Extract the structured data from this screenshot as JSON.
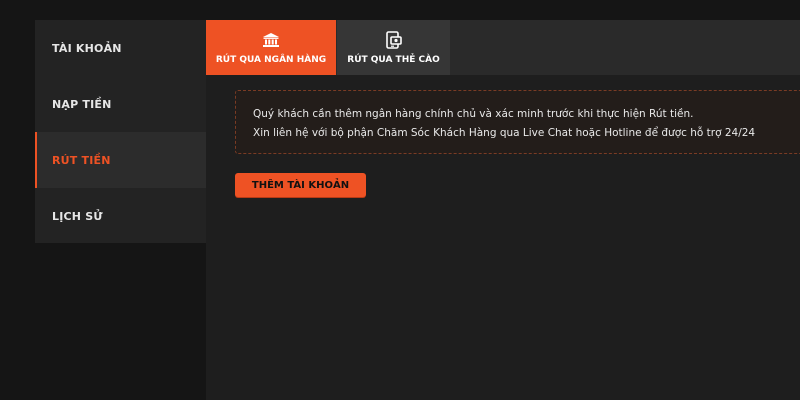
{
  "sidebar": {
    "items": [
      {
        "label": "TÀI KHOẢN"
      },
      {
        "label": "NẠP TIỀN"
      },
      {
        "label": "RÚT TIỀN",
        "active": true
      },
      {
        "label": "LỊCH SỬ"
      }
    ]
  },
  "tabs": [
    {
      "label": "RÚT QUA NGÂN HÀNG",
      "icon": "bank-icon",
      "active": true
    },
    {
      "label": "RÚT QUA THẺ CÀO",
      "icon": "phone-card-icon"
    }
  ],
  "notice": {
    "line1": "Quý khách cần thêm ngân hàng chính chủ và xác minh trước khi thực hiện Rút tiền.",
    "line2": "Xin liên hệ với bộ phận Chăm Sóc Khách Hàng qua Live Chat hoặc Hotline để được hỗ trợ 24/24"
  },
  "add_account_button": {
    "label": "THÊM TÀI KHOẢN"
  },
  "colors": {
    "accent": "#ee5224",
    "background": "#151515",
    "panel": "#1e1e1e",
    "sidebar": "#232323"
  }
}
